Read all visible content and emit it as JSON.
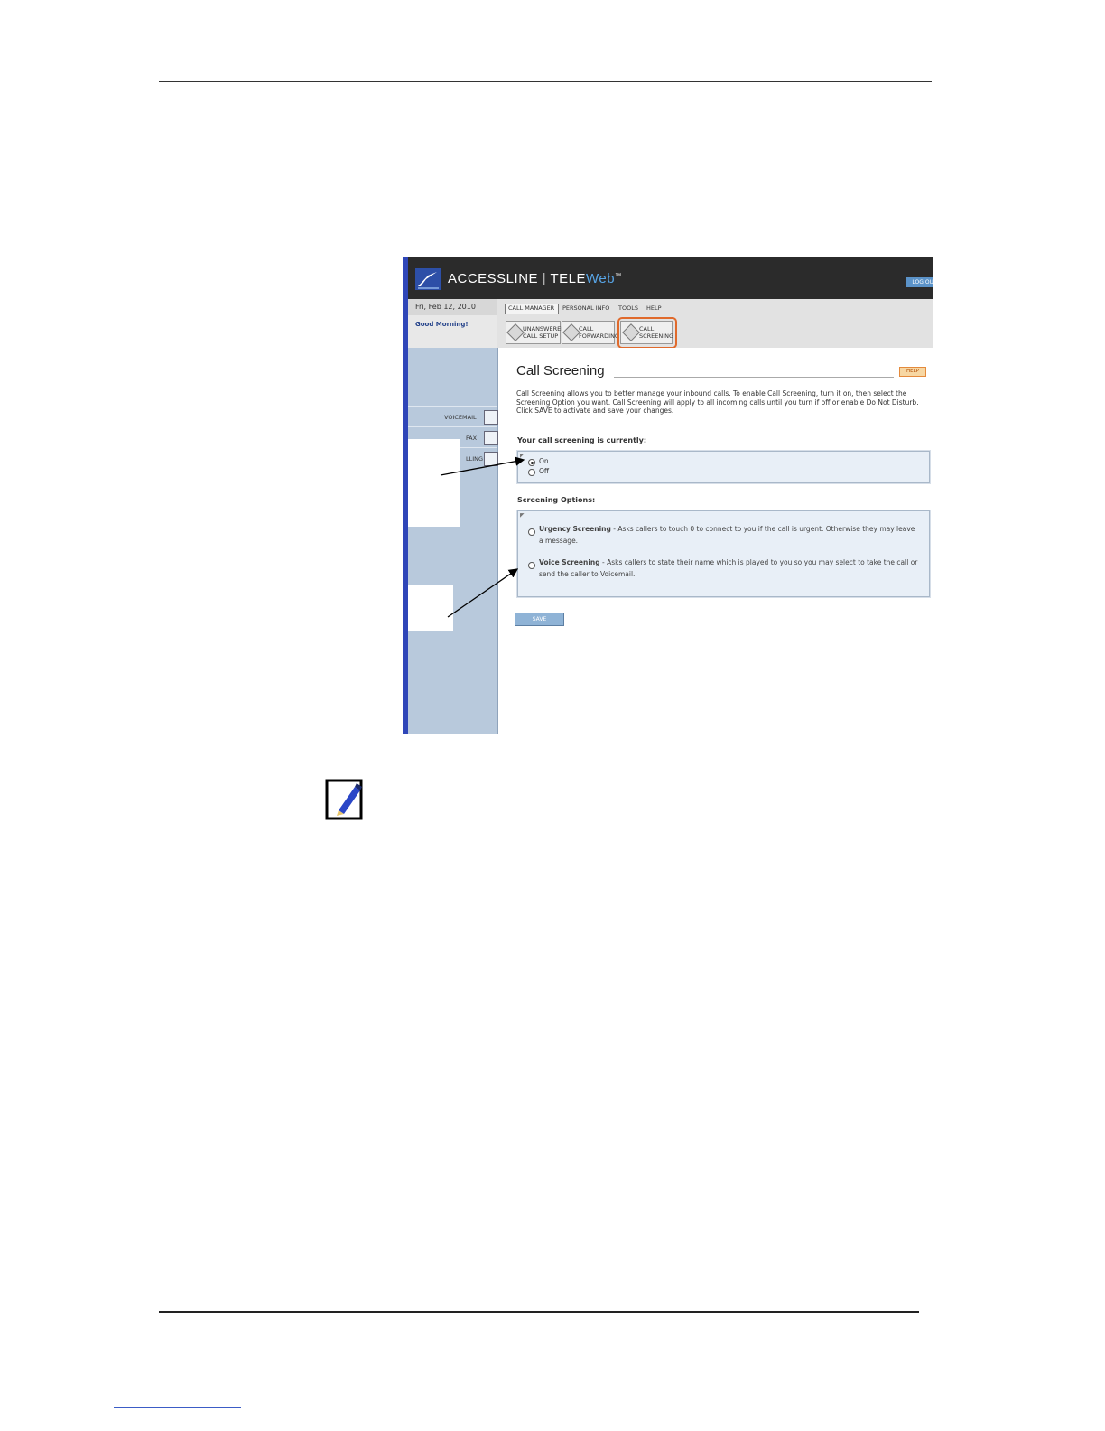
{
  "app": {
    "logo_brand": "ACCESSLINE",
    "logo_tele": "TELE",
    "logo_web": "Web",
    "logo_tm": "™",
    "logout_label": "LOG OUT"
  },
  "status": {
    "date": "Fri, Feb 12, 2010",
    "greeting": "Good Morning!"
  },
  "nav": {
    "tabs": [
      {
        "label": "CALL MANAGER"
      },
      {
        "label": "PERSONAL INFO"
      },
      {
        "label": "TOOLS"
      },
      {
        "label": "HELP"
      }
    ],
    "tools": [
      {
        "line1": "UNANSWERED",
        "line2": "CALL SETUP"
      },
      {
        "line1": "CALL",
        "line2": "FORWARDING"
      },
      {
        "line1": "CALL",
        "line2": "SCREENING"
      }
    ]
  },
  "sidebar": {
    "items": [
      {
        "label": "VOICEMAIL"
      },
      {
        "label": "FAX"
      },
      {
        "label": "LLING"
      }
    ]
  },
  "page": {
    "title": "Call Screening",
    "help_label": "HELP",
    "description": "Call Screening allows you to better manage your inbound calls. To enable Call Screening, turn it on, then select the Screening Option you want. Call Screening will apply to all incoming calls until you turn if off or enable Do Not Disturb. Click SAVE to activate and save your changes.",
    "status_heading": "Your call screening is currently:",
    "status_options": [
      {
        "label": "On",
        "selected": true
      },
      {
        "label": "Off",
        "selected": false
      }
    ],
    "options_heading": "Screening Options:",
    "screening_options": [
      {
        "name": "Urgency Screening",
        "desc": " - Asks callers to touch 0 to connect to you if the call is urgent. Otherwise they may leave a message."
      },
      {
        "name": "Voice Screening",
        "desc": " - Asks callers to state their name which is played to you so you may select to take the call or send the caller to Voicemail."
      }
    ],
    "save_label": "SAVE"
  },
  "colors": {
    "header_bg": "#2b2b2b",
    "sidebar_bg": "#b8c9dc",
    "accent_blue": "#2f46b8",
    "highlight_orange": "#e06a2c",
    "option_box_bg": "#e8eff7"
  }
}
